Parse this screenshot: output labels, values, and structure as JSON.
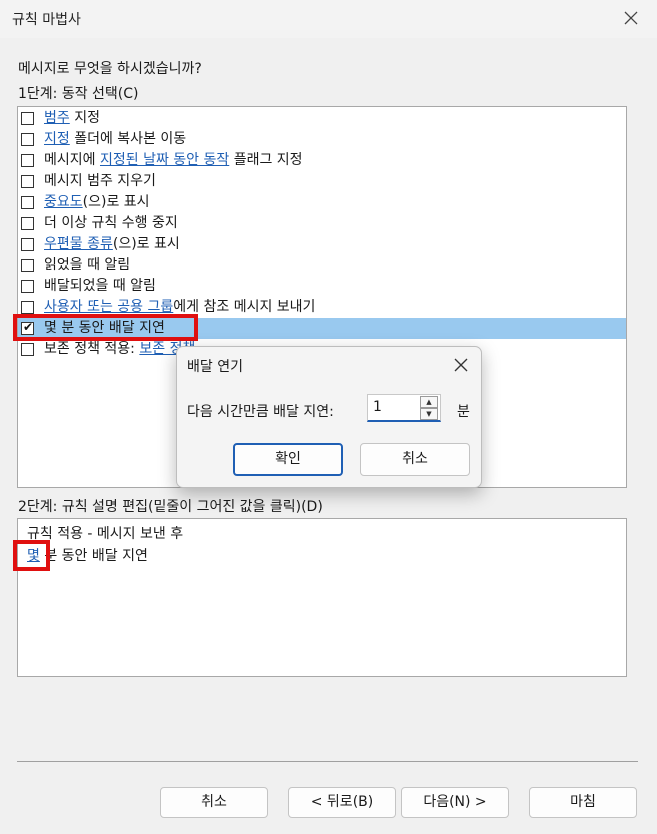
{
  "window": {
    "title": "규칙 마법사"
  },
  "question": "메시지로 무엇을 하시겠습니까?",
  "step1": {
    "label": "1단계: 동작 선택(C)"
  },
  "actions": [
    {
      "parts": [
        {
          "t": "범주",
          "link": true
        },
        {
          "t": " 지정",
          "link": false
        }
      ],
      "checked": false
    },
    {
      "parts": [
        {
          "t": "지정",
          "link": true
        },
        {
          "t": " 폴더에 복사본 이동",
          "link": false
        }
      ],
      "checked": false
    },
    {
      "parts": [
        {
          "t": "메시지에 ",
          "link": false
        },
        {
          "t": "지정된 날짜 동안 동작",
          "link": true
        },
        {
          "t": " 플래그 지정",
          "link": false
        }
      ],
      "checked": false
    },
    {
      "parts": [
        {
          "t": "메시지 범주 지우기",
          "link": false
        }
      ],
      "checked": false
    },
    {
      "parts": [
        {
          "t": "중요도",
          "link": true
        },
        {
          "t": "(으)로 표시",
          "link": false
        }
      ],
      "checked": false
    },
    {
      "parts": [
        {
          "t": "더 이상 규칙 수행 중지",
          "link": false
        }
      ],
      "checked": false
    },
    {
      "parts": [
        {
          "t": "우편물 종류",
          "link": true
        },
        {
          "t": "(으)로 표시",
          "link": false
        }
      ],
      "checked": false
    },
    {
      "parts": [
        {
          "t": "읽었을 때 알림",
          "link": false
        }
      ],
      "checked": false
    },
    {
      "parts": [
        {
          "t": "배달되었을 때 알림",
          "link": false
        }
      ],
      "checked": false
    },
    {
      "parts": [
        {
          "t": "사용자 또는 공용 그룹",
          "link": true
        },
        {
          "t": "에게 참조 메시지 보내기",
          "link": false
        }
      ],
      "checked": false
    },
    {
      "parts": [
        {
          "t": "몇 분 동안 배달 지연",
          "link": false
        }
      ],
      "checked": true,
      "selected": true
    },
    {
      "parts": [
        {
          "t": "보존 정책 적용: ",
          "link": false
        },
        {
          "t": "보존 정책",
          "link": true
        }
      ],
      "checked": false
    }
  ],
  "step2": {
    "label": "2단계: 규칙 설명 편집(밑줄이 그어진 값을 클릭)(D)"
  },
  "description": {
    "line1": "규칙 적용 - 메시지 보낸 후",
    "link": "몇",
    "rest": " 분 동안 배달 지연"
  },
  "buttons": {
    "cancel": "취소",
    "back": "< 뒤로(B)",
    "next": "다음(N) >",
    "finish": "마침"
  },
  "dialog": {
    "title": "배달 연기",
    "prompt": "다음 시간만큼 배달 지연:",
    "value": "1",
    "unit": "분",
    "ok": "확인",
    "cancel": "취소"
  },
  "colors": {
    "selection": "#99c9ef",
    "link": "#1f5fb4",
    "highlight": "#e01010"
  }
}
